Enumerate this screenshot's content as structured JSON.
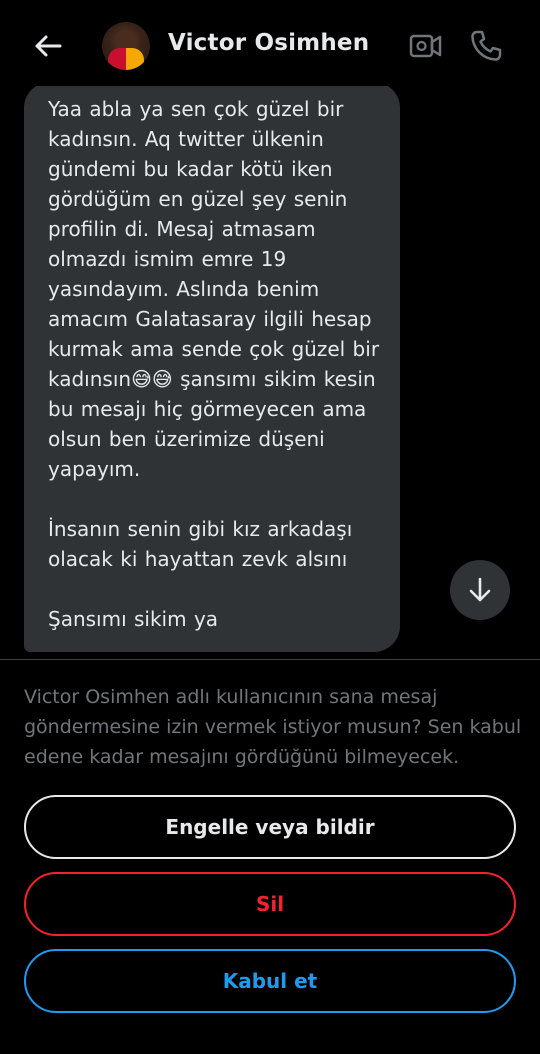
{
  "header": {
    "back_icon": "arrow-left-icon",
    "contact_name": "Victor Osimhen",
    "video_icon": "video-camera-icon",
    "call_icon": "phone-icon"
  },
  "message": {
    "paragraphs": [
      "Yaa abla ya sen çok güzel bir kadınsın. Aq twitter ülkenin gündemi bu kadar kötü iken gördüğüm en güzel şey senin profilin di. Mesaj atmasam olmazdı ismim emre 19 yasındayım. Aslında benim amacım Galatasaray ilgili hesap kurmak ama sende çok güzel bir kadınsın😅😅 şansımı sikim kesin bu mesajı hiç görmeyecen ama olsun ben üzerimize düşeni yapayım.",
      "İnsanın senin gibi kız arkadaşı olacak ki hayattan zevk alsını",
      "Şansımı sikim ya"
    ]
  },
  "scroll_down_icon": "arrow-down-icon",
  "request": {
    "text": "Victor Osimhen adlı kullanıcının sana mesaj göndermesine izin vermek istiyor musun? Sen kabul edene kadar mesajını gördüğünü bilmeyecek."
  },
  "actions": {
    "block_report": "Engelle veya bildir",
    "delete": "Sil",
    "accept": "Kabul et"
  },
  "colors": {
    "background": "#000000",
    "bubble": "#2f3336",
    "text_primary": "#e7e9ea",
    "text_secondary": "#71767b",
    "danger": "#f4212e",
    "accent": "#1d9bf0"
  }
}
